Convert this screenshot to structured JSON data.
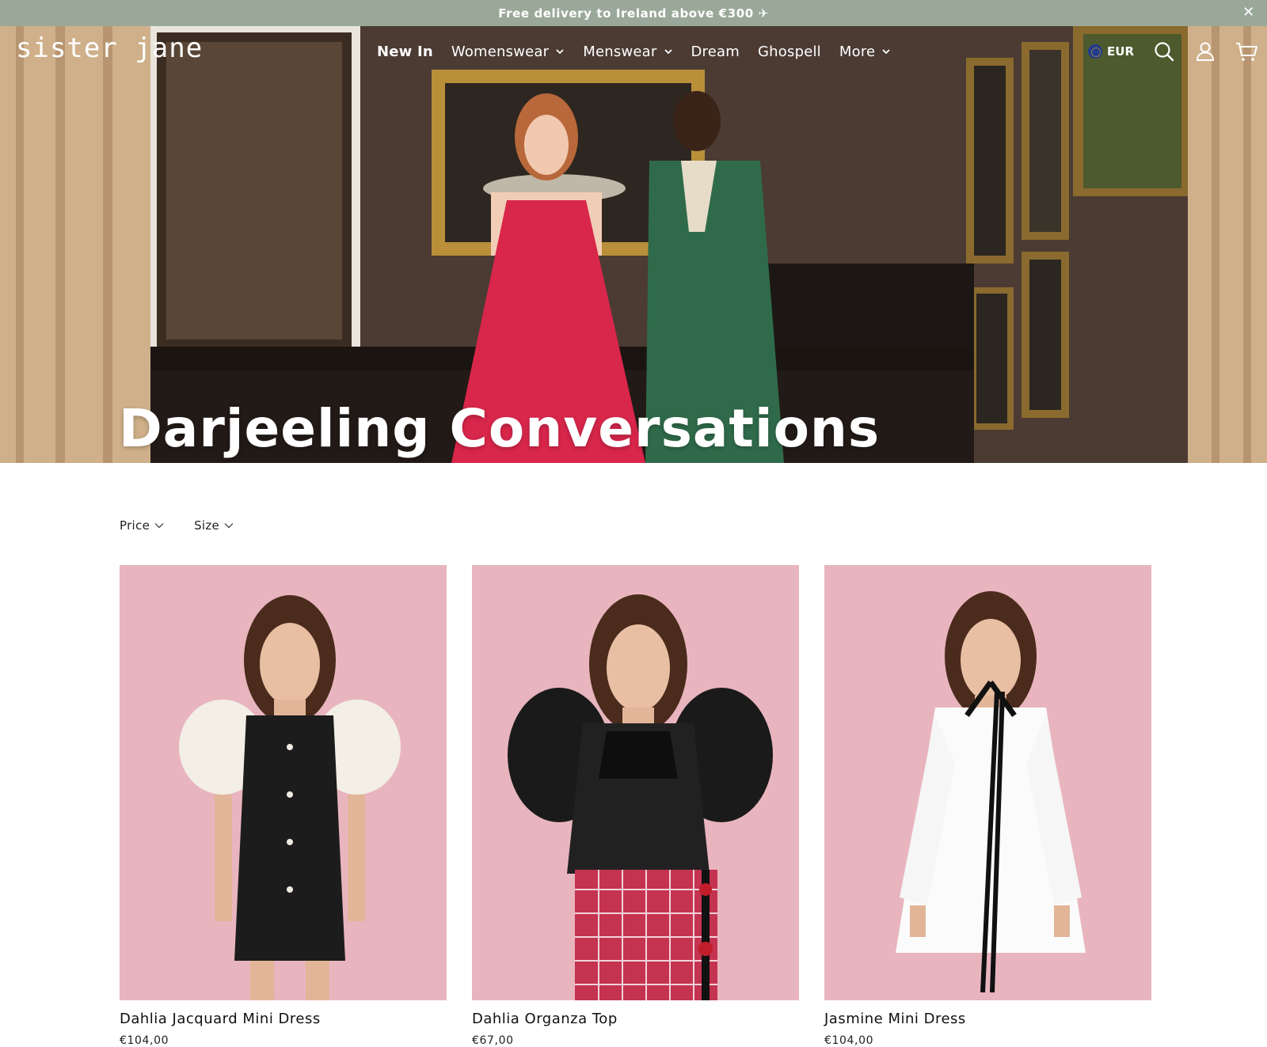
{
  "announcement": {
    "text": "Free delivery to Ireland above €300 ✈",
    "close_icon": "close-icon"
  },
  "header": {
    "logo": "sister jane",
    "nav": [
      {
        "label": "New In",
        "dropdown": false
      },
      {
        "label": "Womenswear",
        "dropdown": true
      },
      {
        "label": "Menswear",
        "dropdown": true
      },
      {
        "label": "Dream",
        "dropdown": false
      },
      {
        "label": "Ghospell",
        "dropdown": false
      },
      {
        "label": "More",
        "dropdown": true
      }
    ],
    "currency": "EUR",
    "icons": [
      "eu-flag-icon",
      "search-icon",
      "account-icon",
      "cart-icon"
    ]
  },
  "hero": {
    "title": "Darjeeling Conversations"
  },
  "filters": {
    "price": "Price",
    "size": "Size"
  },
  "products": [
    {
      "name": "Dahlia Jacquard Mini Dress",
      "price": "€104,00"
    },
    {
      "name": "Dahlia Organza Top",
      "price": "€67,00"
    },
    {
      "name": "Jasmine Mini Dress",
      "price": "€104,00"
    }
  ],
  "colors": {
    "announcement_bg": "#9aa89a",
    "product_bg": "#e8b5be"
  }
}
